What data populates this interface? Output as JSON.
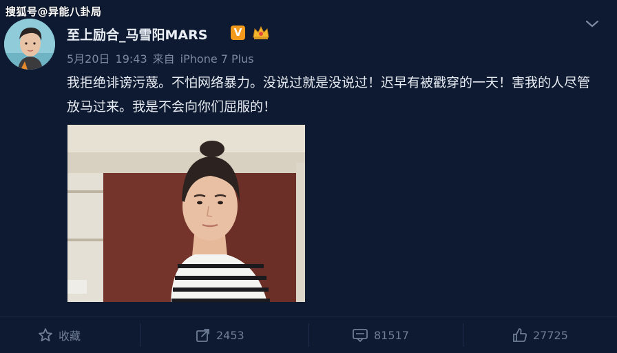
{
  "watermark": "搜狐号@异能八卦局",
  "post": {
    "username": "至上励合_马雪阳MARS",
    "verified_badge": "V",
    "date": "5月20日",
    "time": "19:43",
    "source_prefix": "来自",
    "source_device": "iPhone 7 Plus",
    "text": "我拒绝诽谤污蔑。不怕网络暴力。没说过就是没说过！迟早有被戳穿的一天！害我的人尽管放马过来。我是不会向你们屈服的！"
  },
  "actions": {
    "favorite_label": "收藏",
    "repost_count": "2453",
    "comment_count": "81517",
    "like_count": "27725"
  },
  "icons": {
    "verified": "verified-v-icon",
    "member": "crown-icon",
    "menu": "chevron-down-icon",
    "favorite": "star-icon",
    "repost": "share-arrow-icon",
    "comment": "comment-icon",
    "like": "thumbs-up-icon"
  },
  "colors": {
    "background": "#0e1a31",
    "text_primary": "#e6ebf2",
    "text_secondary": "#7c8aa3",
    "badge_orange": "#f39a1c"
  }
}
